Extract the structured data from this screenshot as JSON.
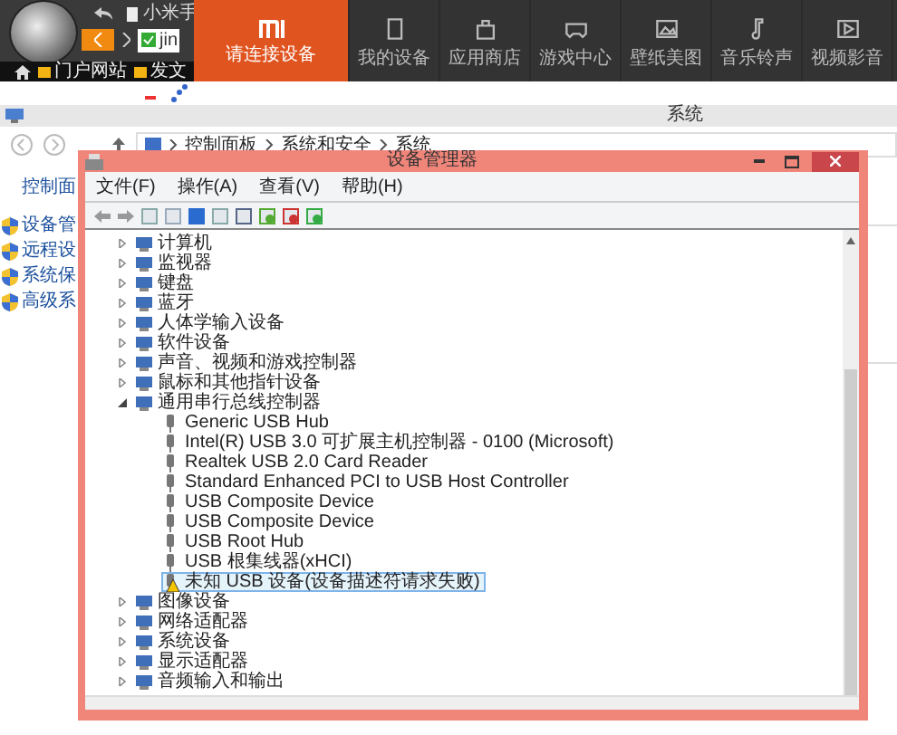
{
  "browser": {
    "tab_title": "小米手",
    "address": "jin",
    "bookmarks": [
      "门户网站",
      "发文"
    ]
  },
  "mi_panel": {
    "tabs": [
      {
        "label": "请连接设备",
        "selected": true
      },
      {
        "label": "我的设备",
        "selected": false
      },
      {
        "label": "应用商店",
        "selected": false
      },
      {
        "label": "游戏中心",
        "selected": false
      },
      {
        "label": "壁纸美图",
        "selected": false
      },
      {
        "label": "音乐铃声",
        "selected": false
      },
      {
        "label": "视频影音",
        "selected": false
      }
    ]
  },
  "system_window": {
    "title": "系统",
    "breadcrumb": [
      "控制面板",
      "系统和安全",
      "系统"
    ],
    "sidebar": {
      "heading": "控制面",
      "items": [
        "设备管",
        "远程设",
        "系统保",
        "高级系"
      ]
    }
  },
  "device_manager": {
    "title": "设备管理器",
    "menu": [
      "文件(F)",
      "操作(A)",
      "查看(V)",
      "帮助(H)"
    ],
    "tree": [
      {
        "label": "计算机",
        "expanded": false
      },
      {
        "label": "监视器",
        "expanded": false
      },
      {
        "label": "键盘",
        "expanded": false
      },
      {
        "label": "蓝牙",
        "expanded": false
      },
      {
        "label": "人体学输入设备",
        "expanded": false
      },
      {
        "label": "软件设备",
        "expanded": false
      },
      {
        "label": "声音、视频和游戏控制器",
        "expanded": false
      },
      {
        "label": "鼠标和其他指针设备",
        "expanded": false
      },
      {
        "label": "通用串行总线控制器",
        "expanded": true,
        "children": [
          {
            "label": "Generic USB Hub",
            "selected": false,
            "warning": false
          },
          {
            "label": "Intel(R) USB 3.0 可扩展主机控制器 - 0100 (Microsoft)",
            "selected": false,
            "warning": false
          },
          {
            "label": "Realtek USB 2.0 Card Reader",
            "selected": false,
            "warning": false
          },
          {
            "label": "Standard Enhanced PCI to USB Host Controller",
            "selected": false,
            "warning": false
          },
          {
            "label": "USB Composite Device",
            "selected": false,
            "warning": false
          },
          {
            "label": "USB Composite Device",
            "selected": false,
            "warning": false
          },
          {
            "label": "USB Root Hub",
            "selected": false,
            "warning": false
          },
          {
            "label": "USB 根集线器(xHCI)",
            "selected": false,
            "warning": false
          },
          {
            "label": "未知 USB 设备(设备描述符请求失败)",
            "selected": true,
            "warning": true
          }
        ]
      },
      {
        "label": "图像设备",
        "expanded": false
      },
      {
        "label": "网络适配器",
        "expanded": false
      },
      {
        "label": "系统设备",
        "expanded": false
      },
      {
        "label": "显示适配器",
        "expanded": false
      },
      {
        "label": "音频输入和输出",
        "expanded": false
      }
    ]
  }
}
